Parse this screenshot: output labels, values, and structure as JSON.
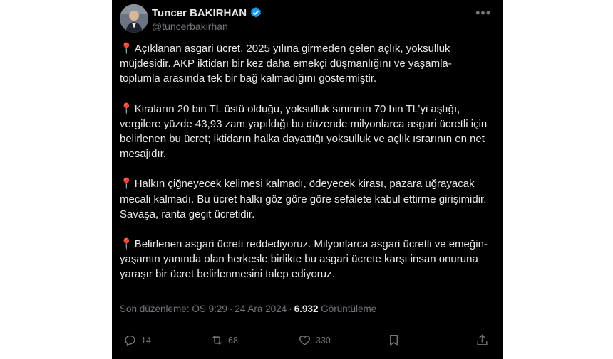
{
  "tweet": {
    "author": {
      "name": "Tuncer BAKIRHAN",
      "handle": "@tuncerbakirhan"
    },
    "paragraphs": [
      "Açıklanan asgari ücret, 2025 yılına girmeden gelen açlık, yoksulluk müjdesidir. AKP iktidarı bir kez daha emekçi düşmanlığını ve yaşamla-toplumla arasında tek bir bağ kalmadığını göstermiştir.",
      "Kiraların 20 bin TL üstü olduğu, yoksulluk sınırının 70 bin TL’yi aştığı, vergilere yüzde 43,93 zam yapıldığı bu düzende milyonlarca asgari ücretli için belirlenen bu ücret; iktidarın halka dayattığı yoksulluk ve açlık ısrarının en net mesajıdır.",
      "Halkın çiğneyecek kelimesi kalmadı, ödeyecek kirası, pazara uğrayacak mecali kalmadı. Bu ücret halkı göz göre göre sefalete kabul ettirme girişimidir. Savaşa, ranta geçit ücretidir.",
      "Belirlenen asgari ücreti reddediyoruz. Milyonlarca asgari ücretli ve emeğin-yaşamın yanında olan herkesle birlikte bu asgari ücrete karşı insan onuruna yaraşır bir ücret belirlenmesini talep ediyoruz."
    ],
    "meta": {
      "edited_time": "Son düzenleme: ÖS 9:29",
      "date": "24 Ara 2024",
      "views_count": "6.932",
      "views_label": "Görüntüleme"
    },
    "actions": {
      "replies": "14",
      "reposts": "68",
      "likes": "330"
    },
    "colors": {
      "background": "#000000",
      "text": "#e7e9ea",
      "muted": "#71767b",
      "verified": "#1d9bf0",
      "pin": "#e0245e"
    }
  }
}
